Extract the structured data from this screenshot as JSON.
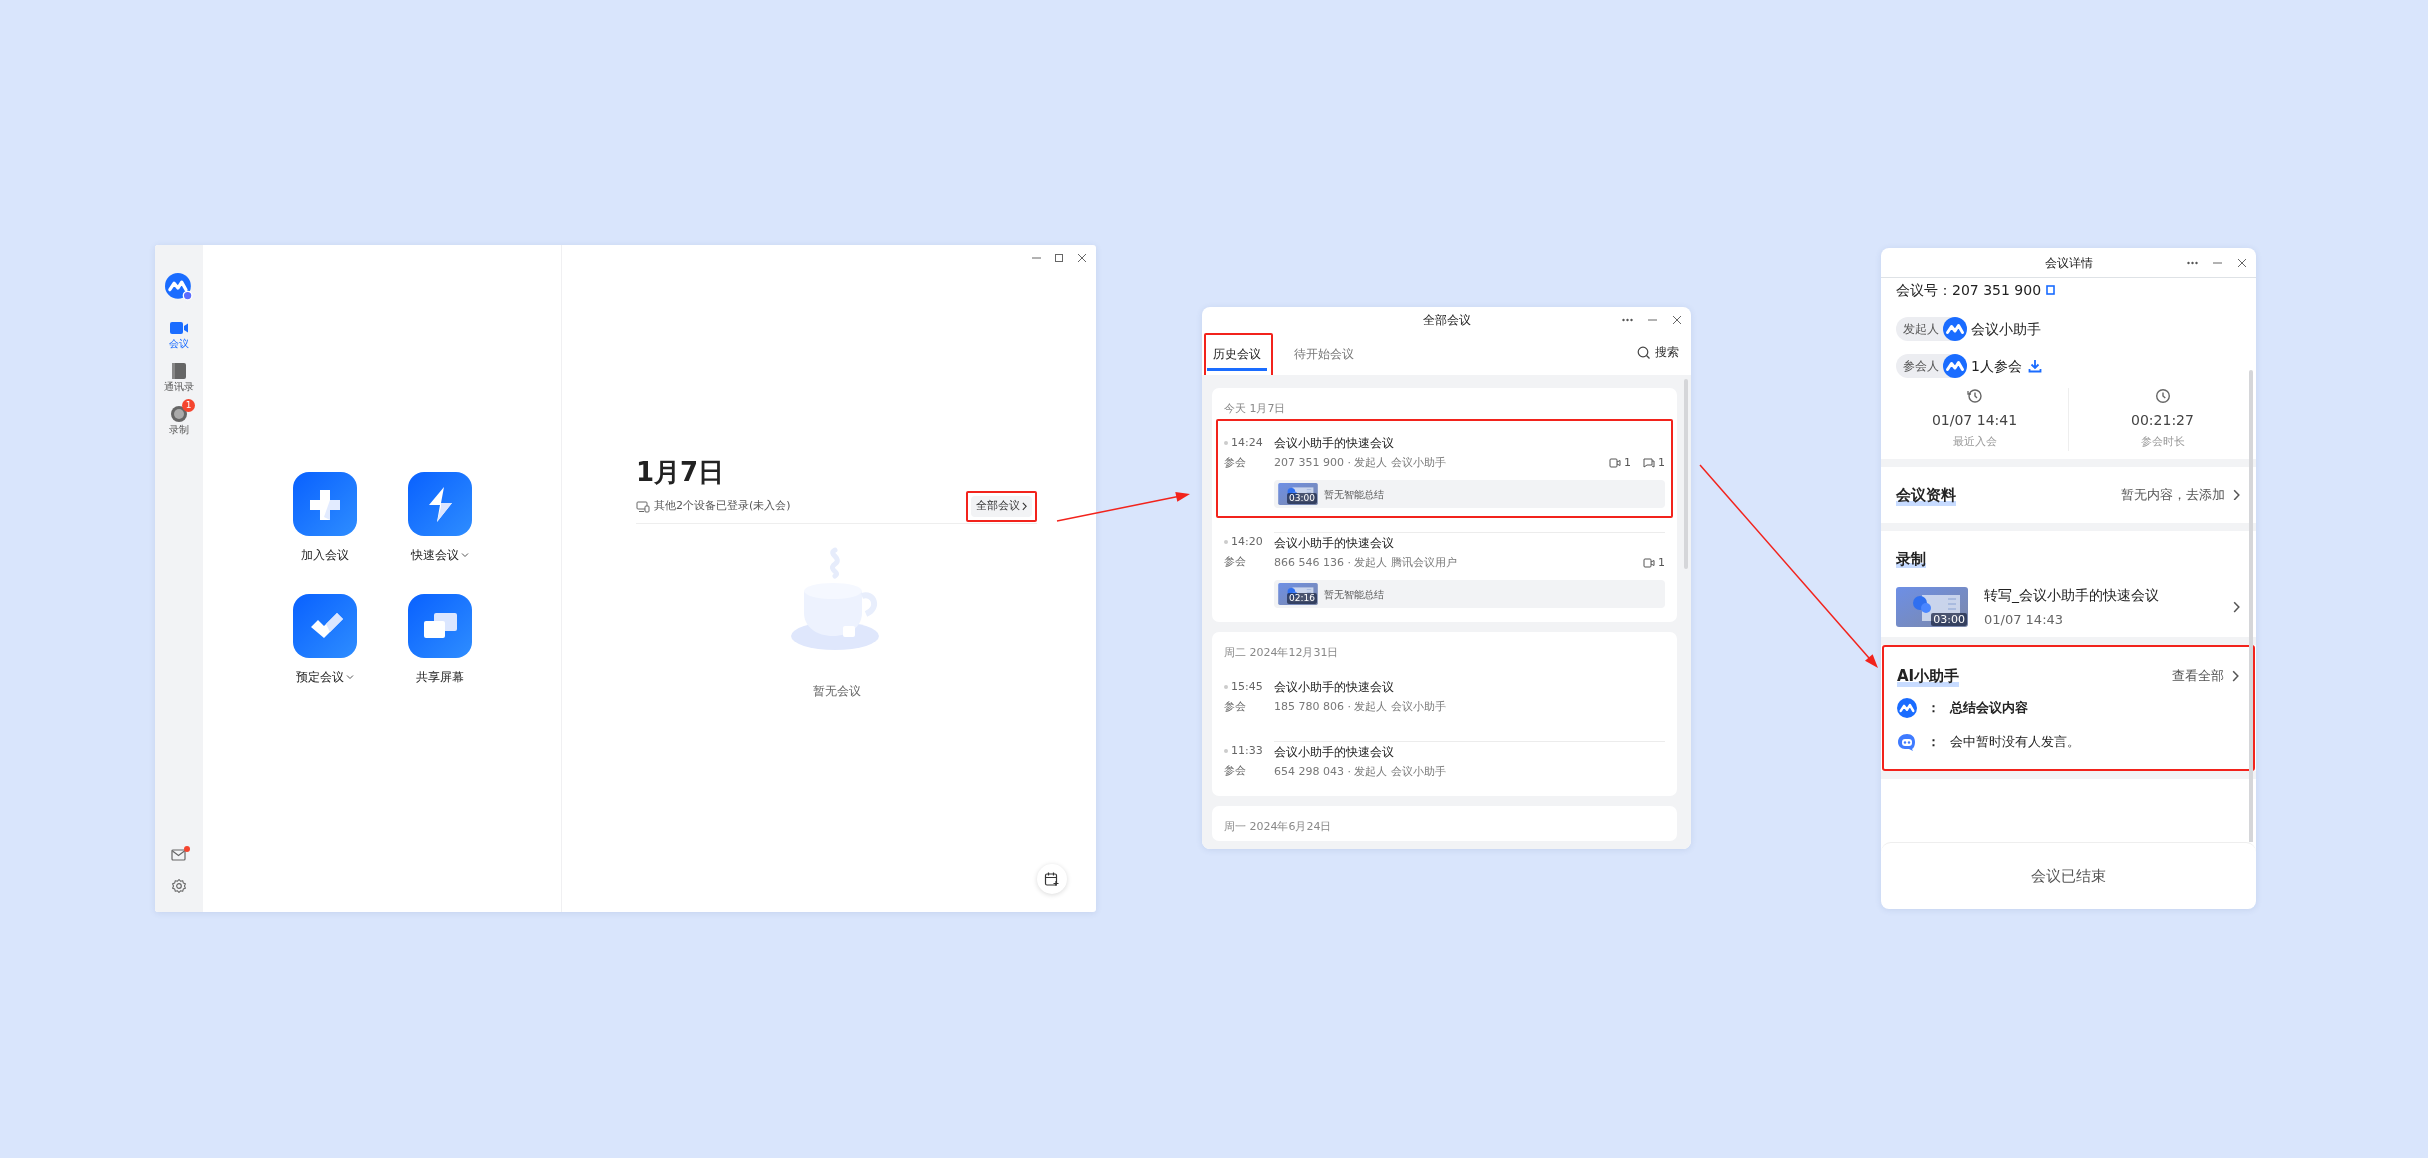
{
  "main_window": {
    "sidebar": {
      "items": [
        {
          "label": "会议",
          "kind": "meeting",
          "selected": true
        },
        {
          "label": "通讯录",
          "kind": "contacts",
          "selected": false
        },
        {
          "label": "录制",
          "kind": "recording",
          "selected": false,
          "badge": "1"
        }
      ],
      "mail_unread": true
    },
    "actions": [
      {
        "label": "加入会议",
        "kind": "join",
        "dropdown": false
      },
      {
        "label": "快速会议",
        "kind": "quick",
        "dropdown": true
      },
      {
        "label": "预定会议",
        "kind": "schedule",
        "dropdown": true
      },
      {
        "label": "共享屏幕",
        "kind": "share",
        "dropdown": false
      }
    ],
    "date": "1月7日",
    "device_notice": "其他2个设备已登录(未入会)",
    "all_meetings_button": {
      "label": "全部会议",
      "highlighted": true
    },
    "empty_text": "暂无会议"
  },
  "meetings_window": {
    "title": "全部会议",
    "tabs": [
      {
        "label": "历史会议",
        "selected": true,
        "highlighted": true
      },
      {
        "label": "待开始会议",
        "selected": false,
        "highlighted": false
      }
    ],
    "search": "搜索",
    "groups": [
      {
        "date": "今天 1月7日",
        "meetings": [
          {
            "time": "14:24",
            "title": "会议小助手的快速会议",
            "role": "参会",
            "details": "207 351 900 · 发起人 会议小助手",
            "video_count": "1",
            "chat_count": "1",
            "summary": "暂无智能总结",
            "duration": "03:00",
            "highlighted": true
          },
          {
            "time": "14:20",
            "title": "会议小助手的快速会议",
            "role": "参会",
            "details": "866 546 136 · 发起人 腾讯会议用户",
            "video_count": "1",
            "summary": "暂无智能总结",
            "duration": "02:16",
            "highlighted": false
          }
        ]
      },
      {
        "date": "周二 2024年12月31日",
        "meetings": [
          {
            "time": "15:45",
            "title": "会议小助手的快速会议",
            "role": "参会",
            "details": "185 780 806 · 发起人 会议小助手",
            "highlighted": false
          },
          {
            "time": "11:33",
            "title": "会议小助手的快速会议",
            "role": "参会",
            "details": "654 298 043 · 发起人 会议小助手",
            "highlighted": false
          }
        ]
      },
      {
        "date": "周一 2024年6月24日"
      }
    ]
  },
  "detail_window": {
    "title": "会议详情",
    "meeting_number": "会议号：207 351 900",
    "host_label": "发起人",
    "host": "会议小助手",
    "attendee_label": "参会人",
    "attendees": "1人参会",
    "stats": [
      {
        "kind": "history",
        "value": "01/07 14:41",
        "label": "最近入会"
      },
      {
        "kind": "clock",
        "value": "00:21:27",
        "label": "参会时长"
      }
    ],
    "materials": {
      "title": "会议资料",
      "action": "暂无内容，去添加"
    },
    "recording": {
      "title": "录制",
      "items": [
        {
          "name": "转写_会议小助手的快速会议",
          "time": "01/07 14:43",
          "duration": "03:00"
        }
      ]
    },
    "ai": {
      "title": "AI小助手",
      "view_all": "查看全部",
      "highlighted": true,
      "messages": [
        {
          "kind": "prompt",
          "delimiter": "：",
          "text": "总结会议内容"
        },
        {
          "kind": "reply",
          "delimiter": "：",
          "text": "会中暂时没有人发言。"
        }
      ]
    },
    "footer": "会议已结束"
  }
}
